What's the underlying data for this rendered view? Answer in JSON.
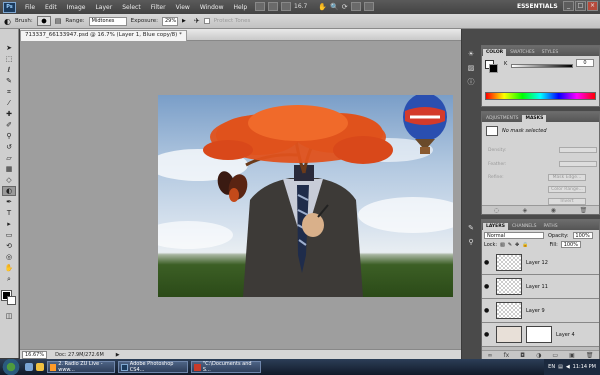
{
  "menubar": {
    "logo": "Ps",
    "menus": [
      "File",
      "Edit",
      "Image",
      "Layer",
      "Select",
      "Filter",
      "View",
      "Window",
      "Help"
    ],
    "zoom_value": "16.7",
    "workspace": "ESSENTIALS"
  },
  "options": {
    "brush_label": "Brush:",
    "range_label": "Range:",
    "range_value": "Midtones",
    "exposure_label": "Exposure:",
    "exposure_value": "29%",
    "protect_label": "Protect Tones"
  },
  "document": {
    "tab_title": "713337_66133947.psd @ 16.7% (Layer 1, Blue copy/8) *",
    "zoom": "16.67%",
    "doc_info": "Doc: 27.9M/272.6M"
  },
  "panels": {
    "color_tabs": [
      "COLOR",
      "SWATCHES",
      "STYLES"
    ],
    "color_k_label": "K",
    "color_k_value": "0",
    "masks_tabs": [
      "ADJUSTMENTS",
      "MASKS"
    ],
    "no_mask": "No mask selected",
    "density_label": "Density:",
    "feather_label": "Feather:",
    "refine_label": "Refine:",
    "mask_edge": "Mask Edge...",
    "color_range": "Color Range...",
    "invert": "Invert",
    "layers_tabs": [
      "LAYERS",
      "CHANNELS",
      "PATHS"
    ],
    "blend_mode": "Normal",
    "opacity_label": "Opacity:",
    "opacity_value": "100%",
    "lock_label": "Lock:",
    "fill_label": "Fill:",
    "fill_value": "100%",
    "layers": [
      {
        "name": "Layer 12"
      },
      {
        "name": "Layer 11"
      },
      {
        "name": "Layer 9"
      },
      {
        "name": "Layer 4"
      }
    ]
  },
  "taskbar": {
    "tasks": [
      "2. Radio ZU Live - www...",
      "Adobe Photoshop CS4...",
      "\"C:\\Documents and S..."
    ],
    "time": "11:14 PM",
    "lang": "EN"
  }
}
